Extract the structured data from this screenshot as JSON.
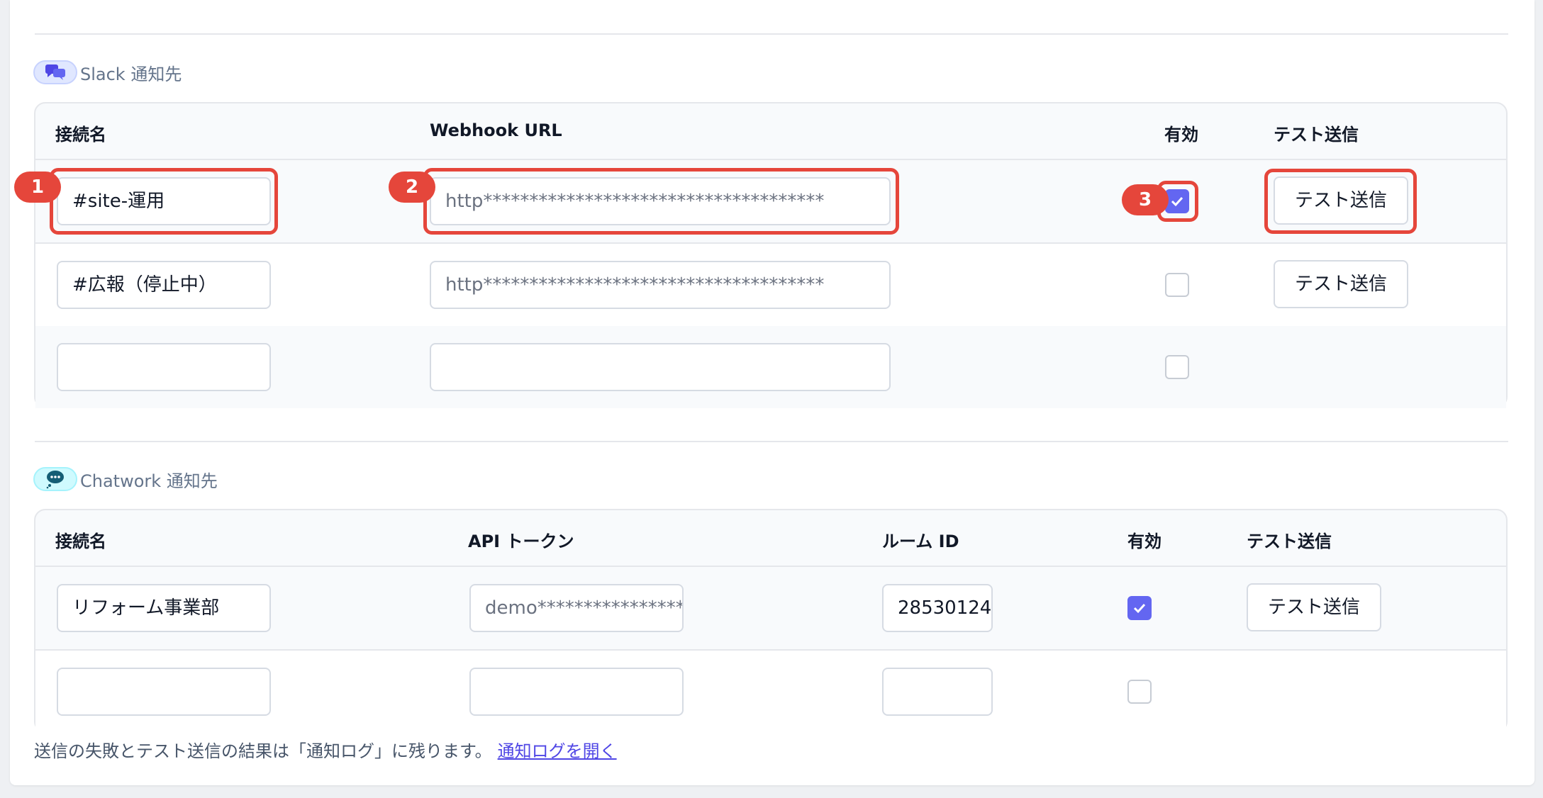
{
  "slack": {
    "section_title": "Slack 通知先",
    "headers": {
      "name": "接続名",
      "url": "Webhook URL",
      "enabled": "有効",
      "test": "テスト送信"
    },
    "rows": [
      {
        "name": "#site-運用",
        "url": "http*************************************",
        "enabled": true,
        "test_label": "テスト送信"
      },
      {
        "name": "#広報（停止中）",
        "url": "http*************************************",
        "enabled": false,
        "test_label": "テスト送信"
      },
      {
        "name": "",
        "url": "",
        "enabled": false
      }
    ]
  },
  "chatwork": {
    "section_title": "Chatwork 通知先",
    "headers": {
      "name": "接続名",
      "token": "API トークン",
      "room": "ルーム ID",
      "enabled": "有効",
      "test": "テスト送信"
    },
    "rows": [
      {
        "name": "リフォーム事業部",
        "token": "demo****************",
        "room": "28530124",
        "enabled": true,
        "test_label": "テスト送信"
      },
      {
        "name": "",
        "token": "",
        "room": "",
        "enabled": false
      }
    ]
  },
  "annotations": {
    "badge1": "1",
    "badge2": "2",
    "badge3": "3"
  },
  "footer": {
    "note": "送信の失敗とテスト送信の結果は「通知ログ」に残ります。",
    "link": "通知ログを開く"
  },
  "colors": {
    "accent": "#6366f1",
    "highlight": "#e5463b",
    "link": "#4f46e5"
  }
}
